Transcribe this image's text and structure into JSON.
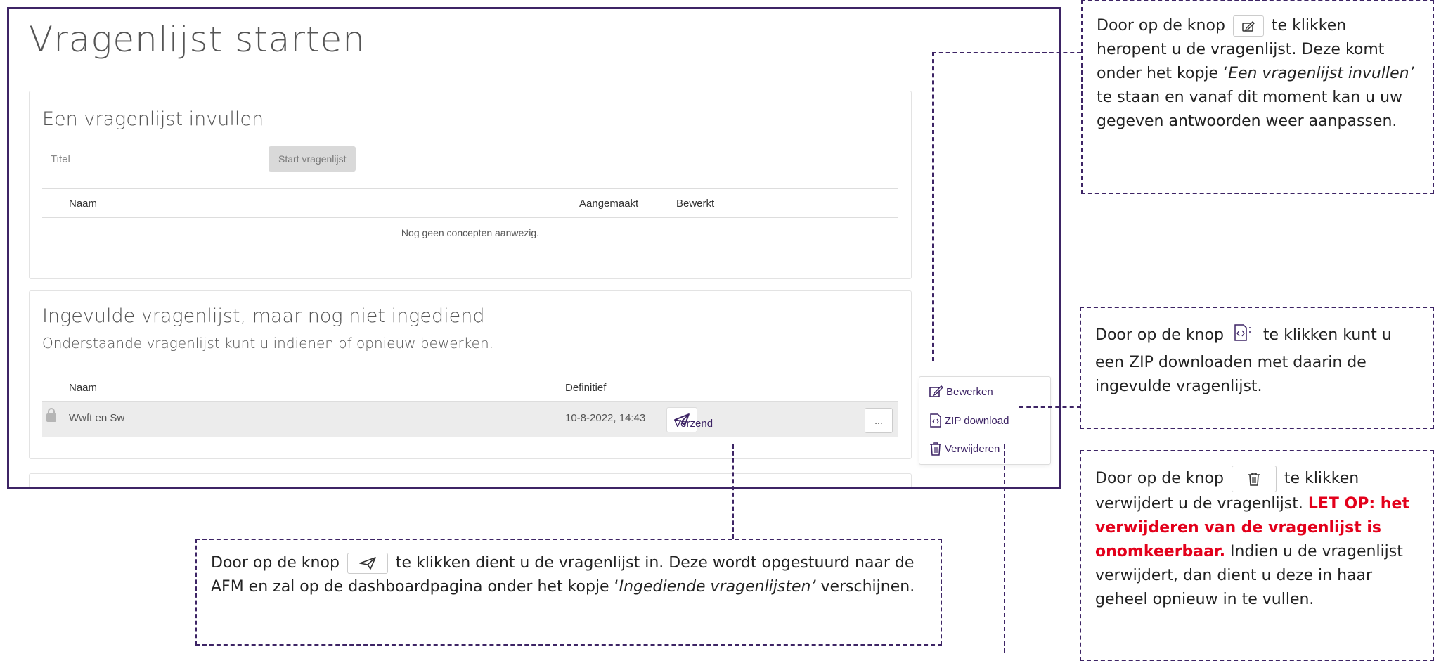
{
  "app": {
    "page_title": "Vragenlijst starten"
  },
  "fill_in_section": {
    "title": "Een vragenlijst invullen",
    "title_field_label": "Titel",
    "start_button": "Start vragenlijst",
    "columns": [
      "Naam",
      "Aangemaakt",
      "Bewerkt"
    ],
    "empty_message": "Nog geen concepten aanwezig."
  },
  "completed_section": {
    "title": "Ingevulde vragenlijst, maar nog niet ingediend",
    "subtitle": "Onderstaande vragenlijst kunt u indienen of opnieuw bewerken.",
    "columns": [
      "Naam",
      "Definitief"
    ],
    "rows": [
      {
        "name": "Wwft en Sw",
        "definitief": "10-8-2022, 14:43",
        "send_label": "Verzend",
        "more_label": "..."
      }
    ]
  },
  "dropdown": {
    "items": [
      {
        "label": "Bewerken",
        "icon": "edit-icon"
      },
      {
        "label": "ZIP download",
        "icon": "zip-file-icon"
      },
      {
        "label": "Verwijderen",
        "icon": "trash-icon"
      }
    ]
  },
  "notes": {
    "edit": {
      "part1": "Door op de knop",
      "part2": "te klikken heropent u de vragenlijst. Deze komt onder het kopje ‘",
      "italic": "Een vragenlijst invullen’",
      "part3": " te staan en vanaf dit moment kan u uw gegeven antwoorden weer aanpassen."
    },
    "zip": {
      "part1": "Door op de knop",
      "part2": "te klikken kunt u een ZIP downloaden met daarin de ingevulde vragenlijst."
    },
    "delete": {
      "part1": "Door op de knop",
      "part2": "te klikken verwijdert u de vragenlijst. ",
      "warning": "LET OP: het verwijderen van de vragenlijst is onomkeerbaar.",
      "part3": " Indien u de vragenlijst verwijdert, dan dient u deze in haar geheel opnieuw in te vullen."
    },
    "send": {
      "part1": "Door op de knop",
      "part2": "te klikken dient u de vragenlijst in. Deze wordt opgestuurd naar de AFM en zal op de dashboardpagina onder het kopje ‘",
      "italic": "Ingediende vragenlijsten’",
      "part3": " verschijnen."
    }
  },
  "colors": {
    "accent": "#3d2465",
    "warning": "#e3001b"
  }
}
